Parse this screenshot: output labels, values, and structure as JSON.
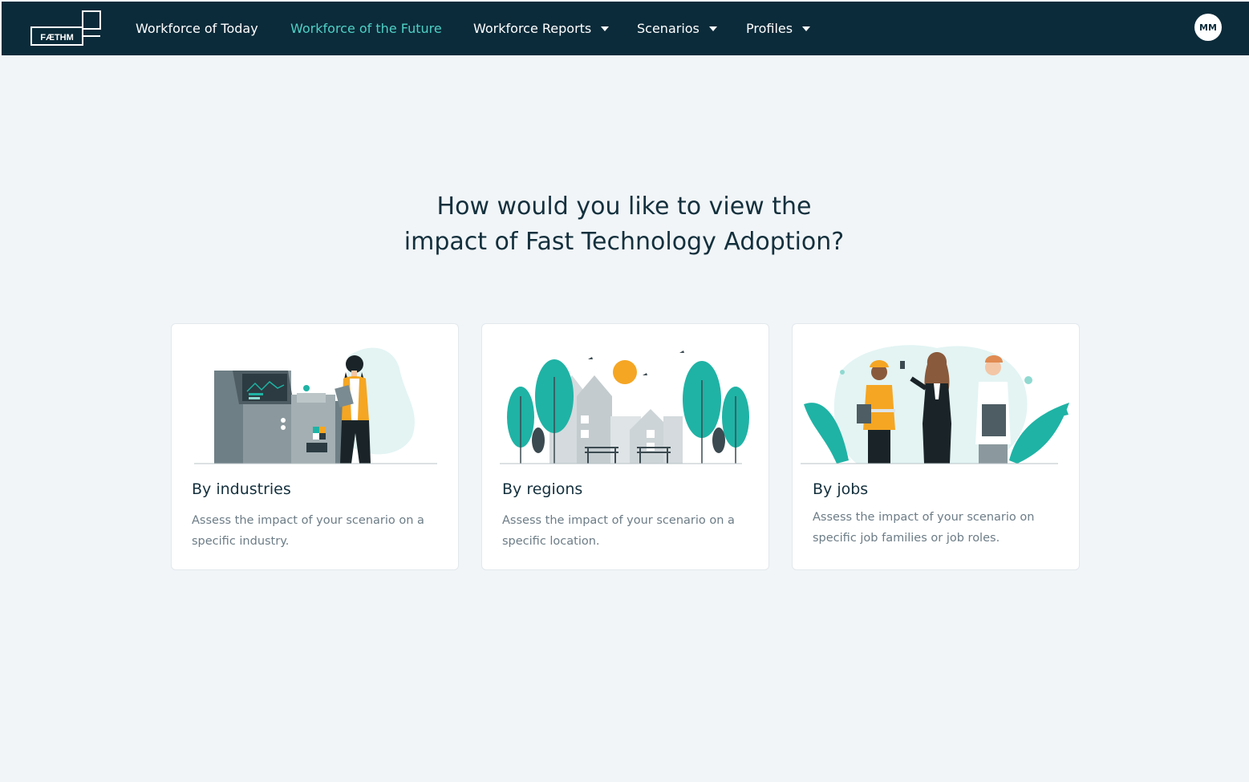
{
  "nav": {
    "logo_text": "FÆTHM",
    "items": [
      {
        "label": "Workforce of Today",
        "active": false,
        "dropdown": false
      },
      {
        "label": "Workforce of the Future",
        "active": true,
        "dropdown": false
      },
      {
        "label": "Workforce Reports",
        "active": false,
        "dropdown": true
      },
      {
        "label": "Scenarios",
        "active": false,
        "dropdown": true
      },
      {
        "label": "Profiles",
        "active": false,
        "dropdown": true
      }
    ],
    "avatar_initials": "MM"
  },
  "main": {
    "title_line1": "How would you like to view the",
    "title_line2": "impact of Fast Technology Adoption?"
  },
  "cards": [
    {
      "title": "By industries",
      "description": "Assess the impact of your scenario on a specific industry."
    },
    {
      "title": "By regions",
      "description": "Assess the impact of your scenario on a specific location."
    },
    {
      "title": "By jobs",
      "description": "Assess the impact of your scenario on specific job families or job roles."
    }
  ],
  "colors": {
    "navbar": "#0b2b3a",
    "accent": "#4fd0c4",
    "teal": "#1fb3a5",
    "background": "#f1f5f8"
  }
}
